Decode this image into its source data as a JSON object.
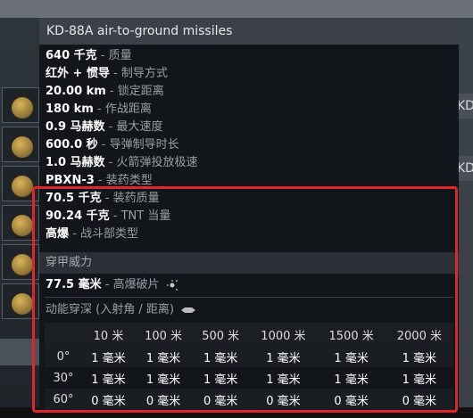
{
  "tooltip": {
    "title": "KD-88A air-to-ground missiles",
    "specs": [
      {
        "value": "640 千克",
        "desc": " - 质量"
      },
      {
        "value": "红外 + 惯导",
        "desc": " - 制导方式"
      },
      {
        "value": "20.00 km",
        "desc": " - 锁定距离"
      },
      {
        "value": "180 km",
        "desc": " - 作战距离"
      },
      {
        "value": "0.9 马赫数",
        "desc": " - 最大速度"
      },
      {
        "value": "600.0 秒",
        "desc": " - 导弹制导时长"
      },
      {
        "value": "1.0 马赫数",
        "desc": " - 火箭弹投放极速"
      },
      {
        "value": "PBXN-3",
        "desc": " - 装药类型"
      },
      {
        "value": "70.5 千克",
        "desc": " - 装药质量"
      },
      {
        "value": "90.24 千克",
        "desc": " - TNT 当量"
      },
      {
        "value": "高爆",
        "desc": " - 战斗部类型"
      }
    ],
    "armor_section": "穿甲威力",
    "penetration": {
      "value": "77.5 毫米",
      "desc": " - 高爆破片"
    },
    "kinetic_title": "动能穿深 (入射角 / 距离)",
    "table": {
      "headers": [
        "",
        "10 米",
        "100 米",
        "500 米",
        "1000 米",
        "1500 米",
        "2000 米"
      ],
      "rows": [
        {
          "angle": "0°",
          "cells": [
            "1 毫米",
            "1 毫米",
            "1 毫米",
            "1 毫米",
            "1 毫米",
            "1 毫米"
          ]
        },
        {
          "angle": "30°",
          "cells": [
            "1 毫米",
            "1 毫米",
            "1 毫米",
            "1 毫米",
            "1 毫米",
            "1 毫米"
          ]
        },
        {
          "angle": "60°",
          "cells": [
            "0 毫米",
            "0 毫米",
            "0 毫米",
            "0 毫米",
            "0 毫米",
            "0 毫米"
          ]
        }
      ]
    }
  },
  "right_panel": {
    "t1": "KD",
    "t2": "KD",
    "frag": [
      "40",
      "红外",
      "00",
      "180",
      "0.9",
      "1.0",
      "PBX"
    ]
  },
  "colors": {
    "highlight": "#e0262d",
    "header_bg": "#3c4147"
  }
}
